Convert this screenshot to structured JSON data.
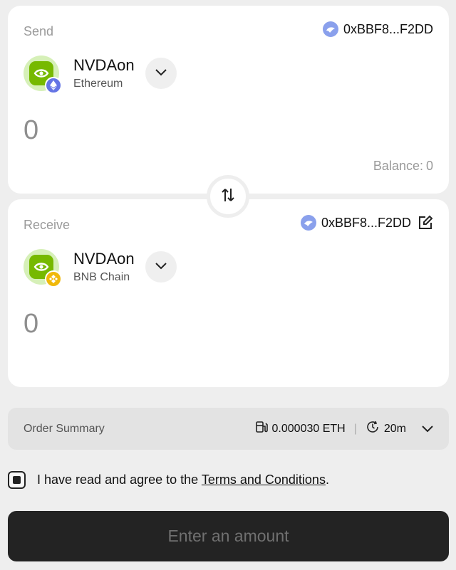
{
  "send": {
    "label": "Send",
    "address": "0xBBF8...F2DD",
    "token_symbol": "NVDAon",
    "token_chain": "Ethereum",
    "amount": "0",
    "balance_label": "Balance:",
    "balance_value": "0"
  },
  "receive": {
    "label": "Receive",
    "address": "0xBBF8...F2DD",
    "token_symbol": "NVDAon",
    "token_chain": "BNB Chain",
    "amount": "0"
  },
  "order_summary": {
    "label": "Order Summary",
    "fee": "0.000030 ETH",
    "separator": "|",
    "time": "20m"
  },
  "terms": {
    "prefix": "I have read and agree to the ",
    "link": "Terms and Conditions",
    "suffix": ".",
    "checked": true
  },
  "submit_label": "Enter an amount",
  "colors": {
    "background": "#eeeeee",
    "card": "#ffffff",
    "nvidia_green": "#76b900",
    "eth_badge": "#6474e5",
    "bnb_badge": "#f0b90b",
    "button_dark": "#232323"
  },
  "icons": {
    "address_avatar": "wallet-avatar-icon",
    "chain_send": "ethereum-icon",
    "chain_receive": "bnb-icon",
    "swap": "swap-arrows-icon",
    "fee": "gas-pump-icon",
    "time": "clock-icon",
    "edit": "edit-icon",
    "dropdown": "chevron-down-icon"
  }
}
